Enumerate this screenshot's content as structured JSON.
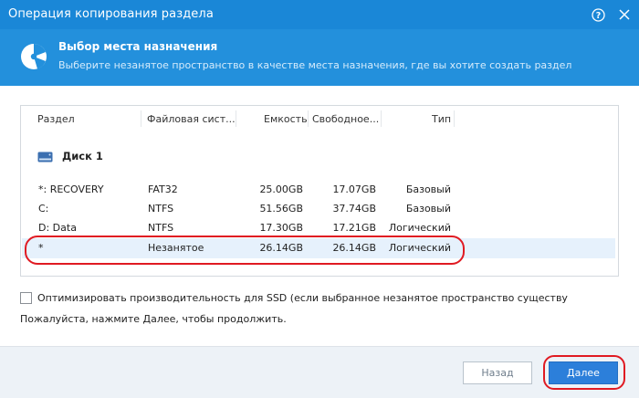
{
  "window": {
    "title": "Операция копирования раздела",
    "help_icon": "?",
    "close_icon": "✕"
  },
  "header": {
    "title": "Выбор места назначения",
    "subtitle": "Выберите незанятое пространство в качестве места назначения, где вы хотите создать раздел",
    "icon": "pie-chart-icon"
  },
  "table": {
    "columns": [
      "Раздел",
      "Файловая сист...",
      "Емкость",
      "Свободное...",
      "Тип"
    ],
    "disk_label": "Диск 1",
    "rows": [
      {
        "name": "*: RECOVERY",
        "fs": "FAT32",
        "capacity": "25.00GB",
        "free": "17.07GB",
        "type": "Базовый"
      },
      {
        "name": "C:",
        "fs": "NTFS",
        "capacity": "51.56GB",
        "free": "37.74GB",
        "type": "Базовый"
      },
      {
        "name": "D: Data",
        "fs": "NTFS",
        "capacity": "17.30GB",
        "free": "17.21GB",
        "type": "Логический"
      },
      {
        "name": "*",
        "fs": "Незанятое",
        "capacity": "26.14GB",
        "free": "26.14GB",
        "type": "Логический"
      }
    ]
  },
  "options": {
    "ssd_label": "Оптимизировать производительность для SSD (если выбранное незанятое пространство существу",
    "ssd_checked": false,
    "hint": "Пожалуйста, нажмите Далее, чтобы продолжить."
  },
  "footer": {
    "back_label": "Назад",
    "next_label": "Далее"
  },
  "colors": {
    "titlebar": "#1a87d7",
    "header": "#2390dc",
    "highlight": "#e01a22",
    "primary_button": "#2c7fda"
  }
}
